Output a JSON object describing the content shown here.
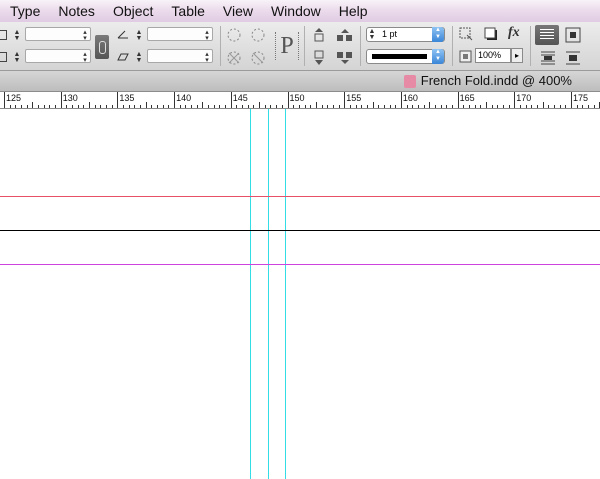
{
  "menubar": {
    "items": [
      "Type",
      "Notes",
      "Object",
      "Table",
      "View",
      "Window",
      "Help"
    ]
  },
  "control_panel": {
    "stroke_weight": "1 pt",
    "opacity": "100%",
    "paragraph_icon_glyph": "P",
    "fx_label": "fx"
  },
  "document_tab": {
    "title": "French Fold.indd @ 400%"
  },
  "ruler": {
    "labels": [
      "125",
      "130",
      "135",
      "140",
      "145",
      "150",
      "155",
      "160",
      "165",
      "170",
      "175"
    ]
  },
  "colors": {
    "guide_cyan": "#33dde6",
    "guide_red": "#e8506a",
    "guide_magenta": "#cc44dd",
    "line_black": "#000000"
  }
}
